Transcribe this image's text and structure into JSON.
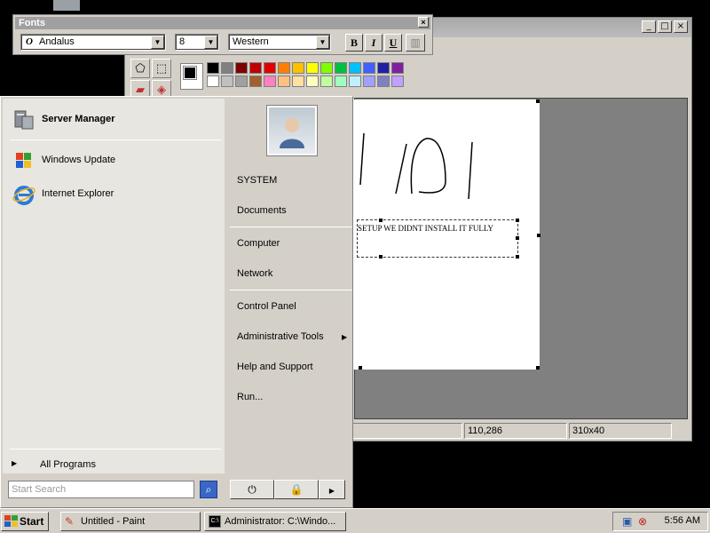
{
  "fonts_toolbar": {
    "title": "Fonts",
    "close_glyph": "×",
    "font_name": "Andalus",
    "font_size": "8",
    "script": "Western",
    "bold": "B",
    "italic": "I",
    "underline": "U"
  },
  "paint": {
    "window_buttons": {
      "minimize": "_",
      "maximize": "□",
      "close": "×"
    },
    "canvas_text": "SETUP WE DIDNT INSTALL IT FULLY",
    "status_coords": "110,286",
    "status_size": "310x40",
    "palette_top": [
      "#000000",
      "#808080",
      "#800000",
      "#c00000",
      "#e00000",
      "#ff8000",
      "#ffc000",
      "#ffff00",
      "#80ff00",
      "#00c040",
      "#00c0ff",
      "#4060ff",
      "#2020a0",
      "#8020a0"
    ],
    "palette_bottom": [
      "#ffffff",
      "#c0c0c0",
      "#a0a0a0",
      "#a06030",
      "#ff80c0",
      "#ffc080",
      "#ffe0a0",
      "#ffffc0",
      "#c0ffa0",
      "#a0ffc0",
      "#c0f0ff",
      "#a0a0ff",
      "#8080c0",
      "#c0a0ff"
    ]
  },
  "start_menu": {
    "pinned": [
      {
        "label": "Server Manager",
        "bold": true
      },
      {
        "label": "Windows Update"
      },
      {
        "label": "Internet Explorer"
      }
    ],
    "right_items": [
      "SYSTEM",
      "Documents",
      "Computer",
      "Network",
      "Control Panel",
      "Administrative Tools",
      "Help and Support",
      "Run..."
    ],
    "all_programs": "All Programs",
    "search_placeholder": "Start Search",
    "arrow": "▶"
  },
  "taskbar": {
    "start_label": "Start",
    "tasks": [
      "Untitled - Paint",
      "Administrator: C:\\Windo..."
    ],
    "clock": "5:56 AM"
  }
}
